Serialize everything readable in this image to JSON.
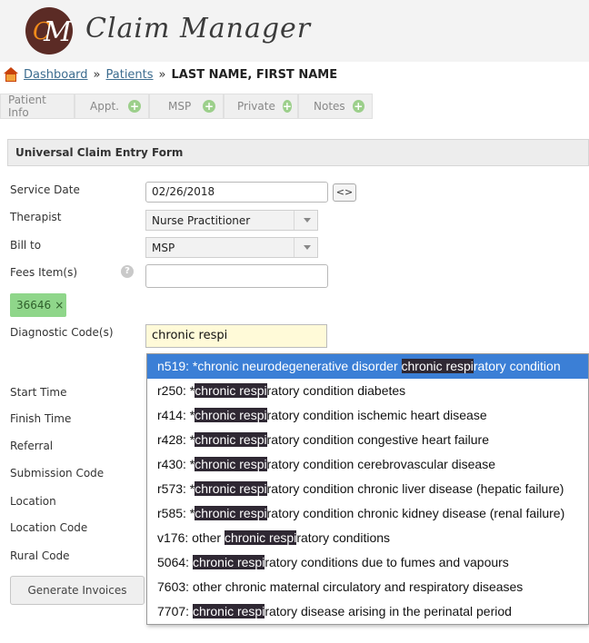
{
  "app": {
    "logo_initials_c": "C",
    "logo_initials_m": "M",
    "logo_text": "Claim Manager"
  },
  "breadcrumb": {
    "dashboard": "Dashboard",
    "patients": "Patients",
    "sep": "»",
    "current": "LAST NAME, FIRST NAME"
  },
  "tabs": [
    {
      "label": "Patient Info",
      "has_add": false
    },
    {
      "label": "Appt.",
      "has_add": true
    },
    {
      "label": "MSP",
      "has_add": true
    },
    {
      "label": "Private",
      "has_add": true
    },
    {
      "label": "Notes",
      "has_add": true
    }
  ],
  "form": {
    "title": "Universal Claim Entry Form",
    "service_date_label": "Service Date",
    "service_date_value": "02/26/2018",
    "swap_label": "<>",
    "therapist_label": "Therapist",
    "therapist_value": "Nurse Practitioner",
    "bill_to_label": "Bill to",
    "bill_to_value": "MSP",
    "fees_label": "Fees Item(s)",
    "help": "?",
    "fee_tag": "36646",
    "fee_tag_remove": "×",
    "diag_label": "Diagnostic Code(s)",
    "diag_value": "chronic respi",
    "start_time_label": "Start Time",
    "finish_time_label": "Finish Time",
    "referral_label": "Referral",
    "submission_code_label": "Submission Code",
    "location_label": "Location",
    "location_code_label": "Location Code",
    "rural_code_label": "Rural Code",
    "generate_button": "Generate Invoices"
  },
  "suggestions": [
    {
      "pre": "n519: *chronic neurodegenerative disorder ",
      "hl": "chronic respi",
      "post": "ratory condition",
      "active": true
    },
    {
      "pre": "r250: *",
      "hl": "chronic respi",
      "post": "ratory condition diabetes"
    },
    {
      "pre": "r414: *",
      "hl": "chronic respi",
      "post": "ratory condition ischemic heart disease"
    },
    {
      "pre": "r428: *",
      "hl": "chronic respi",
      "post": "ratory condition congestive heart failure"
    },
    {
      "pre": "r430: *",
      "hl": "chronic respi",
      "post": "ratory condition cerebrovascular disease"
    },
    {
      "pre": "r573: *",
      "hl": "chronic respi",
      "post": "ratory condition chronic liver disease (hepatic failure)"
    },
    {
      "pre": "r585: *",
      "hl": "chronic respi",
      "post": "ratory condition chronic kidney disease (renal failure)"
    },
    {
      "pre": "v176: other ",
      "hl": "chronic respi",
      "post": "ratory conditions"
    },
    {
      "pre": "5064: ",
      "hl": "chronic respi",
      "post": "ratory conditions due to fumes and vapours"
    },
    {
      "pre": "7603: other chronic maternal circulatory and respiratory diseases",
      "hl": "",
      "post": ""
    },
    {
      "pre": "7707: ",
      "hl": "chronic respi",
      "post": "ratory disease arising in the perinatal period"
    }
  ]
}
